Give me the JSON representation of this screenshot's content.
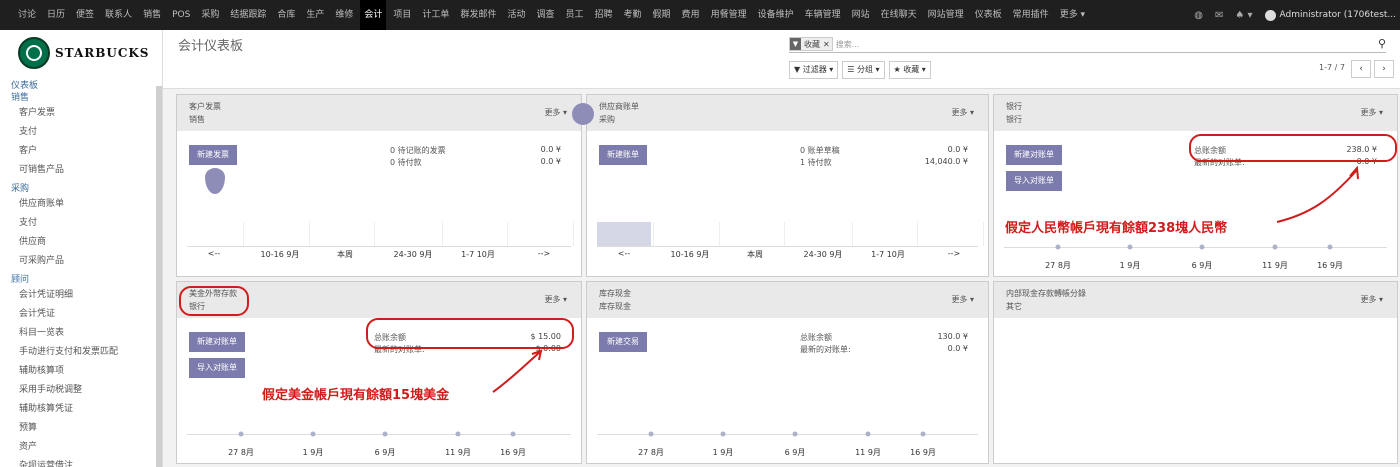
{
  "topnav": {
    "items": [
      "讨论",
      "日历",
      "便签",
      "联系人",
      "销售",
      "POS",
      "采购",
      "结据跟踪",
      "合库",
      "生产",
      "维修",
      "会计",
      "项目",
      "计工单",
      "群发邮件",
      "活动",
      "调查",
      "员工",
      "招聘",
      "考勤",
      "假期",
      "费用",
      "用餐管理",
      "设备维护",
      "车辆管理",
      "网站",
      "在线聊天",
      "网站管理",
      "仪表板",
      "常用插件",
      "更多 ▾"
    ],
    "active_index": 11,
    "user": "Administrator (1706test..."
  },
  "sidebar": {
    "logo_text": "STARBUCKS",
    "sections": [
      {
        "title": "仪表板",
        "items": []
      },
      {
        "title": "销售",
        "items": [
          "客户发票",
          "支付",
          "客户",
          "可销售产品"
        ]
      },
      {
        "title": "采购",
        "items": [
          "供应商账单",
          "支付",
          "供应商",
          "可采购产品"
        ]
      },
      {
        "title": "顾问",
        "items": [
          "会计凭证明细",
          "会计凭证",
          "科目一览表",
          "手动进行支付和发票匹配",
          "辅助核算项",
          "采用手动税调整",
          "辅助核算凭证",
          "预算",
          "资产",
          "杂坝运营借注"
        ]
      }
    ]
  },
  "control": {
    "title": "会计仪表板",
    "facet_label": "收藏",
    "search_placeholder": "搜索...",
    "filter_label": "▼ 过滤器 ▾",
    "group_label": "☰ 分组 ▾",
    "fav_label": "★ 收藏 ▾",
    "pager": "1-7 / 7",
    "prev": "‹",
    "next": "›"
  },
  "cards": [
    {
      "name": "客户发票",
      "type": "销售",
      "more": "更多 ▾",
      "buttons": [
        "新建发票"
      ],
      "stats": [
        {
          "label": "0 待记账的发票",
          "value": "0.0 ¥"
        },
        {
          "label": "0 待付款",
          "value": "0.0 ¥"
        }
      ],
      "xlabels": [
        "<--",
        "10-16 9月",
        "本周",
        "24-30 9月",
        "1-7 10月",
        "-->"
      ],
      "chart": "bar",
      "bar_values": [
        0,
        0,
        0,
        0,
        0,
        0
      ]
    },
    {
      "name": "供应商账单",
      "type": "采购",
      "more": "更多 ▾",
      "buttons": [
        "新建账单"
      ],
      "stats": [
        {
          "label": "0 账单草稿",
          "value": "0.0 ¥"
        },
        {
          "label": "1 待付款",
          "value": "14,040.0 ¥"
        }
      ],
      "xlabels": [
        "<--",
        "10-16 9月",
        "本周",
        "24-30 9月",
        "1-7 10月",
        "-->"
      ],
      "chart": "bar",
      "bar_values": [
        14040,
        0,
        0,
        0,
        0,
        0
      ]
    },
    {
      "name": "银行",
      "type": "银行",
      "more": "更多 ▾",
      "buttons": [
        "新建对账单",
        "导入对账单"
      ],
      "stats": [
        {
          "label": "总账余额",
          "value": "238.0 ¥"
        },
        {
          "label": "最新的对账单:",
          "value": "0.0 ¥"
        }
      ],
      "xlabels": [
        "27 8月",
        "1 9月",
        "6 9月",
        "11 9月",
        "16 9月"
      ],
      "chart": "line"
    },
    {
      "name": "美金外幣存款",
      "type": "银行",
      "more": "更多 ▾",
      "buttons": [
        "新建对账单",
        "导入对账单"
      ],
      "stats": [
        {
          "label": "总账余额",
          "value": "$ 15.00"
        },
        {
          "label": "最新的对账单:",
          "value": "$ 0.00"
        }
      ],
      "xlabels": [
        "27 8月",
        "1 9月",
        "6 9月",
        "11 9月",
        "16 9月"
      ],
      "chart": "line"
    },
    {
      "name": "库存现金",
      "type": "库存现金",
      "more": "更多 ▾",
      "buttons": [
        "新建交易"
      ],
      "stats": [
        {
          "label": "总账余额",
          "value": "130.0 ¥"
        },
        {
          "label": "最新的对账单:",
          "value": "0.0 ¥"
        }
      ],
      "xlabels": [
        "27 8月",
        "1 9月",
        "6 9月",
        "11 9月",
        "16 9月"
      ],
      "chart": "line"
    },
    {
      "name": "内部现金存款轉帳分錄",
      "type": "其它",
      "more": "更多 ▾",
      "buttons": [],
      "stats": [],
      "xlabels": [],
      "chart": "none"
    }
  ],
  "annotations": {
    "rmb_note": "假定人民幣帳戶現有餘額238塊人民幣",
    "usd_note": "假定美金帳戶現有餘額15塊美金"
  },
  "colors": {
    "primary": "#7c7bad",
    "annotation": "#d21c1c",
    "nav": "#1f1f1f"
  }
}
